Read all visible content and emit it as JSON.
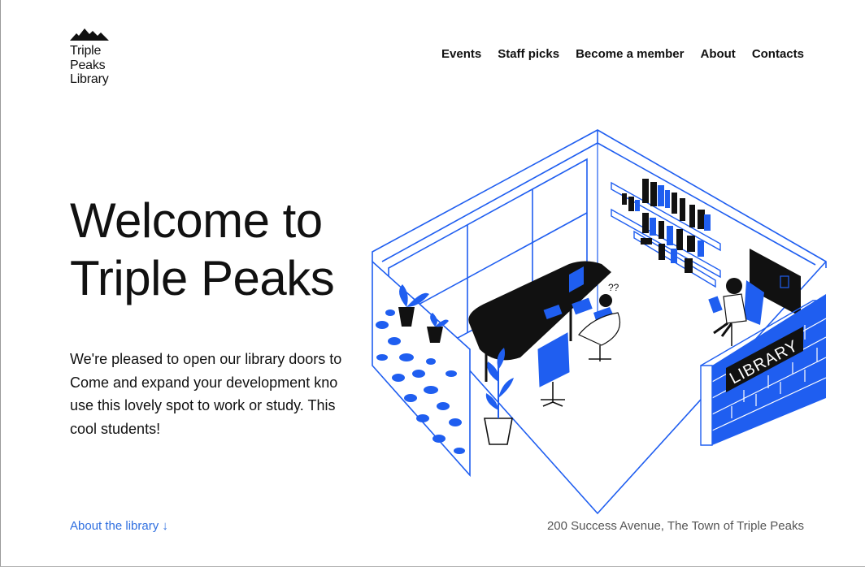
{
  "brand": {
    "line1": "Triple",
    "line2": "Peaks",
    "line3": "Library",
    "logo_icon": "mountain-peaks-icon"
  },
  "nav": {
    "items": [
      {
        "label": "Events"
      },
      {
        "label": "Staff picks"
      },
      {
        "label": "Become a member"
      },
      {
        "label": "About"
      },
      {
        "label": "Contacts"
      }
    ]
  },
  "hero": {
    "title_line1": "Welcome to",
    "title_line2": "Triple Peaks",
    "intro_lines": [
      "We're pleased to open our library doors to",
      "Come and expand your development kno",
      "use this lovely spot to work or study. This",
      "cool students!"
    ],
    "sign_text": "LIBRARY"
  },
  "footer": {
    "about_link": "About the library ↓",
    "address": "200 Success Avenue, The Town of Triple Peaks"
  },
  "colors": {
    "accent": "#1f5ef0",
    "text": "#111111",
    "link": "#2f6fe0",
    "muted": "#555555"
  }
}
